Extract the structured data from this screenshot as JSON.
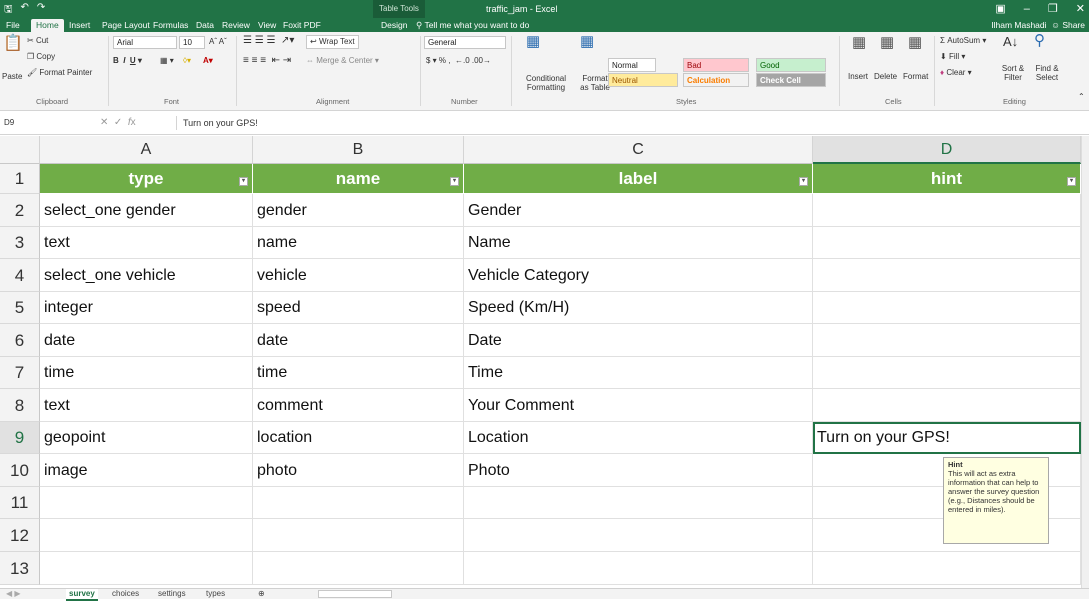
{
  "window": {
    "title": "traffic_jam - Excel",
    "context_tab": "Table Tools",
    "user": "Ilham Mashadi",
    "share": "Share"
  },
  "tabs": [
    "File",
    "Home",
    "Insert",
    "Page Layout",
    "Formulas",
    "Data",
    "Review",
    "View",
    "Foxit PDF",
    "Design"
  ],
  "tell_me": "Tell me what you want to do",
  "ribbon": {
    "clipboard": {
      "paste": "Paste",
      "cut": "Cut",
      "copy": "Copy",
      "format_painter": "Format Painter",
      "label": "Clipboard"
    },
    "font": {
      "name": "Arial",
      "size": "10",
      "label": "Font"
    },
    "alignment": {
      "wrap_text": "Wrap Text",
      "merge": "Merge & Center",
      "label": "Alignment"
    },
    "number": {
      "format": "General",
      "label": "Number",
      "currency": "$",
      "percent": "%",
      "comma": ","
    },
    "styles": {
      "conditional": "Conditional Formatting",
      "format_table": "Format as Table",
      "normal": "Normal",
      "bad": "Bad",
      "good": "Good",
      "neutral": "Neutral",
      "calculation": "Calculation",
      "check_cell": "Check Cell",
      "label": "Styles"
    },
    "cells": {
      "insert": "Insert",
      "delete": "Delete",
      "format": "Format",
      "label": "Cells"
    },
    "editing": {
      "autosum": "AutoSum",
      "fill": "Fill",
      "clear": "Clear",
      "sort": "Sort & Filter",
      "find": "Find & Select",
      "label": "Editing"
    }
  },
  "formula_bar": {
    "name_box": "D9",
    "formula": "Turn on your GPS!"
  },
  "columns": [
    "A",
    "B",
    "C",
    "D"
  ],
  "header_row": [
    "type",
    "name",
    "label",
    "hint"
  ],
  "rows": [
    {
      "num": "1"
    },
    {
      "num": "2",
      "cells": [
        "select_one gender",
        "gender",
        "Gender",
        ""
      ]
    },
    {
      "num": "3",
      "cells": [
        "text",
        "name",
        "Name",
        ""
      ]
    },
    {
      "num": "4",
      "cells": [
        "select_one vehicle",
        "vehicle",
        "Vehicle Category",
        ""
      ]
    },
    {
      "num": "5",
      "cells": [
        "integer",
        "speed",
        "Speed (Km/H)",
        ""
      ]
    },
    {
      "num": "6",
      "cells": [
        "date",
        "date",
        "Date",
        ""
      ]
    },
    {
      "num": "7",
      "cells": [
        "time",
        "time",
        "Time",
        ""
      ]
    },
    {
      "num": "8",
      "cells": [
        "text",
        "comment",
        "Your Comment",
        ""
      ]
    },
    {
      "num": "9",
      "cells": [
        "geopoint",
        "location",
        "Location",
        "Turn on your GPS!"
      ]
    },
    {
      "num": "10",
      "cells": [
        "image",
        "photo",
        "Photo",
        ""
      ]
    },
    {
      "num": "11",
      "cells": [
        "",
        "",
        "",
        ""
      ]
    },
    {
      "num": "12",
      "cells": [
        "",
        "",
        "",
        ""
      ]
    },
    {
      "num": "13",
      "cells": [
        "",
        "",
        "",
        ""
      ]
    }
  ],
  "tooltip": {
    "title": "Hint",
    "body": "This will act as extra information that can help to answer the survey question (e.g., Distances should be entered in miles)."
  },
  "sheets": [
    "survey",
    "choices",
    "settings",
    "types"
  ],
  "colors": {
    "excel_green": "#217346",
    "header_fill": "#70ad47",
    "bad": "#ffc7ce",
    "good": "#c6efce",
    "neutral": "#ffeb9c",
    "check": "#a5a5a5"
  }
}
